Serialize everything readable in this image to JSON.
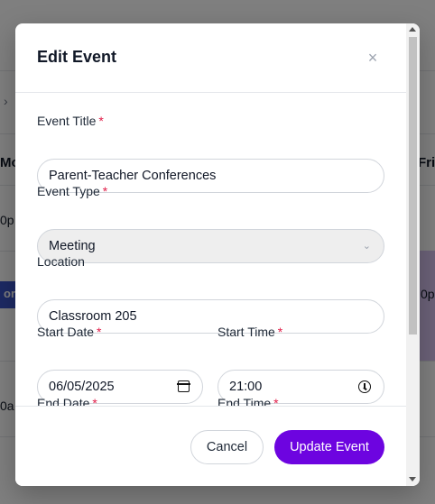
{
  "background": {
    "nav_chevron": "›",
    "day_mon": "Mo",
    "day_fri": "Fri",
    "time_a": "0p",
    "time_b": "0p",
    "time_c": "0a",
    "event_blue": "or l"
  },
  "modal": {
    "title": "Edit Event",
    "close_glyph": "×",
    "required_mark": "*",
    "fields": {
      "event_title": {
        "label": "Event Title",
        "value": "Parent-Teacher Conferences"
      },
      "event_type": {
        "label": "Event Type",
        "value": "Meeting",
        "chevron": "⌄"
      },
      "location": {
        "label": "Location",
        "value": "Classroom 205"
      },
      "start_date": {
        "label": "Start Date",
        "value": "06/05/2025"
      },
      "start_time": {
        "label": "Start Time",
        "value": "21:00"
      },
      "end_date": {
        "label": "End Date"
      },
      "end_time": {
        "label": "End Time"
      }
    },
    "buttons": {
      "cancel": "Cancel",
      "update": "Update Event"
    }
  },
  "colors": {
    "primary": "#6d04e0",
    "required": "#e11d48",
    "event_blue": "#3b55c8",
    "event_purple": "#d9c5f2"
  },
  "icons": {
    "close": "close-icon",
    "chevron": "chevron-down-icon",
    "date": "calendar-icon",
    "time": "clock-icon"
  }
}
